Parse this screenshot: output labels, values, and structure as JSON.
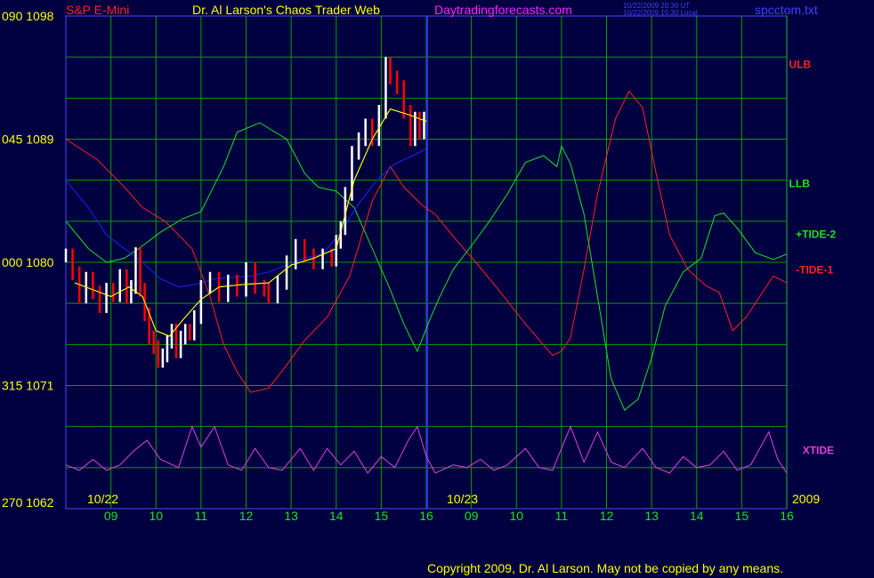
{
  "header": {
    "instrument": "S&P E-Mini",
    "title": "Dr. Al Larson's Chaos Trader Web",
    "site": "Daytradingforecasts.com",
    "timestamp_ut": "10/22/2009 20:30 UT",
    "timestamp_local": "10/22/2009 15:30 Local",
    "file": "spcctom.txt"
  },
  "footer": {
    "copyright": "Copyright 2009, Dr. Al Larson. May not be copied by any means."
  },
  "colors": {
    "background": "#000040",
    "grid": "#00a000",
    "frame": "#3030c0",
    "price_up": "#ffffff",
    "price_down": "#ff0000",
    "ulb": "#ff2020",
    "llb": "#20e020",
    "xtide": "#e040e0",
    "moving_avg": "#ffff00",
    "blue_line": "#2020ff",
    "divider": "#3030ff"
  },
  "chart_data": {
    "type": "line",
    "title": "S&P E-Mini",
    "ylabel": "",
    "y_axis_labels": [
      {
        "angle": "090",
        "price": "1098"
      },
      {
        "angle": "045",
        "price": "1089"
      },
      {
        "angle": "000",
        "price": "1080"
      },
      {
        "angle": "315",
        "price": "1071"
      },
      {
        "angle": "270",
        "price": "1062"
      }
    ],
    "ylim": [
      1062,
      1098
    ],
    "xlim": [
      8,
      24
    ],
    "x_tick_labels": [
      "09",
      "10",
      "11",
      "12",
      "13",
      "14",
      "15",
      "16",
      "09",
      "10",
      "11",
      "12",
      "13",
      "14",
      "15",
      "16"
    ],
    "x_tick_positions": [
      9,
      10,
      11,
      12,
      13,
      14,
      15,
      16,
      17,
      18,
      19,
      20,
      21,
      22,
      23,
      24
    ],
    "date_labels": [
      "10/22",
      "10/23"
    ],
    "year_label": "2009",
    "divider_x": 16,
    "series": [
      {
        "name": "ULB",
        "points": [
          [
            8,
            1089
          ],
          [
            8.7,
            1087.5
          ],
          [
            9.3,
            1085.5
          ],
          [
            9.7,
            1084
          ],
          [
            10.2,
            1083
          ],
          [
            10.8,
            1081
          ],
          [
            11.2,
            1077.5
          ],
          [
            11.5,
            1074
          ],
          [
            11.8,
            1072
          ],
          [
            12.1,
            1070.5
          ],
          [
            12.5,
            1070.8
          ],
          [
            12.9,
            1072.5
          ],
          [
            13.3,
            1074.3
          ],
          [
            13.8,
            1076
          ],
          [
            14.3,
            1079
          ],
          [
            14.8,
            1084.5
          ],
          [
            15.2,
            1087
          ],
          [
            15.5,
            1085.5
          ],
          [
            15.9,
            1084.2
          ],
          [
            16.2,
            1083.5
          ],
          [
            16.7,
            1081.5
          ],
          [
            17.1,
            1080
          ],
          [
            17.6,
            1078
          ],
          [
            18.2,
            1075.5
          ],
          [
            18.8,
            1073.2
          ],
          [
            19,
            1073.5
          ],
          [
            19.2,
            1074.5
          ],
          [
            19.5,
            1079.5
          ],
          [
            19.8,
            1085
          ],
          [
            20.2,
            1090.5
          ],
          [
            20.5,
            1092.5
          ],
          [
            20.8,
            1091.3
          ],
          [
            21.1,
            1086.5
          ],
          [
            21.4,
            1082
          ],
          [
            21.8,
            1079.5
          ],
          [
            22.2,
            1078.3
          ],
          [
            22.5,
            1077.8
          ],
          [
            22.8,
            1075
          ],
          [
            23.1,
            1076
          ],
          [
            23.4,
            1077.5
          ],
          [
            23.7,
            1079
          ],
          [
            24,
            1078.5
          ]
        ]
      },
      {
        "name": "LLB",
        "points": [
          [
            8,
            1083
          ],
          [
            8.5,
            1081
          ],
          [
            8.9,
            1080
          ],
          [
            9.3,
            1080.3
          ],
          [
            9.7,
            1081.2
          ],
          [
            10.1,
            1082.2
          ],
          [
            10.6,
            1083.2
          ],
          [
            11,
            1083.7
          ],
          [
            11.5,
            1087
          ],
          [
            11.8,
            1089.5
          ],
          [
            12.3,
            1090.2
          ],
          [
            12.9,
            1089
          ],
          [
            13.3,
            1086.5
          ],
          [
            13.6,
            1085.5
          ],
          [
            14,
            1085.2
          ],
          [
            14.4,
            1084
          ],
          [
            14.8,
            1081
          ],
          [
            15.2,
            1078
          ],
          [
            15.5,
            1075.5
          ],
          [
            15.8,
            1073.5
          ],
          [
            16.1,
            1076
          ],
          [
            16.3,
            1077.5
          ],
          [
            16.6,
            1079.5
          ],
          [
            17,
            1081.2
          ],
          [
            17.4,
            1083
          ],
          [
            17.8,
            1085
          ],
          [
            18.2,
            1087.3
          ],
          [
            18.6,
            1087.8
          ],
          [
            18.9,
            1087
          ],
          [
            19,
            1088.5
          ],
          [
            19.2,
            1087.2
          ],
          [
            19.5,
            1083.5
          ],
          [
            19.8,
            1077.5
          ],
          [
            20.1,
            1071.5
          ],
          [
            20.4,
            1069.2
          ],
          [
            20.7,
            1070
          ],
          [
            21,
            1073
          ],
          [
            21.3,
            1076.8
          ],
          [
            21.7,
            1079.3
          ],
          [
            22.1,
            1080.3
          ],
          [
            22.4,
            1083.4
          ],
          [
            22.6,
            1083.6
          ],
          [
            22.9,
            1082.5
          ],
          [
            23.3,
            1080.7
          ],
          [
            23.7,
            1080.2
          ],
          [
            24,
            1080.6
          ]
        ]
      },
      {
        "name": "XTIDE",
        "points": [
          [
            8,
            1065.2
          ],
          [
            8.3,
            1064.8
          ],
          [
            8.6,
            1065.6
          ],
          [
            8.9,
            1064.8
          ],
          [
            9.2,
            1065.2
          ],
          [
            9.5,
            1066.2
          ],
          [
            9.8,
            1067
          ],
          [
            10.1,
            1065.6
          ],
          [
            10.5,
            1065
          ],
          [
            10.8,
            1068
          ],
          [
            11,
            1066.5
          ],
          [
            11.3,
            1068
          ],
          [
            11.6,
            1065.2
          ],
          [
            11.9,
            1064.8
          ],
          [
            12.2,
            1066.4
          ],
          [
            12.5,
            1065
          ],
          [
            12.8,
            1064.8
          ],
          [
            13.2,
            1066.4
          ],
          [
            13.5,
            1064.8
          ],
          [
            13.8,
            1066.4
          ],
          [
            14.1,
            1065.2
          ],
          [
            14.4,
            1066.2
          ],
          [
            14.7,
            1064.6
          ],
          [
            15,
            1065.8
          ],
          [
            15.3,
            1065
          ],
          [
            15.6,
            1067
          ],
          [
            15.8,
            1068
          ],
          [
            16,
            1065.8
          ],
          [
            16.2,
            1064.6
          ],
          [
            16.6,
            1065.2
          ],
          [
            16.9,
            1065
          ],
          [
            17.2,
            1065.6
          ],
          [
            17.5,
            1064.8
          ],
          [
            17.8,
            1065.2
          ],
          [
            18.2,
            1066.4
          ],
          [
            18.5,
            1065
          ],
          [
            18.8,
            1064.8
          ],
          [
            19.2,
            1068
          ],
          [
            19.5,
            1065.4
          ],
          [
            19.8,
            1067.6
          ],
          [
            20.1,
            1065.4
          ],
          [
            20.4,
            1065
          ],
          [
            20.8,
            1066.4
          ],
          [
            21.1,
            1065
          ],
          [
            21.4,
            1064.6
          ],
          [
            21.7,
            1065.8
          ],
          [
            22,
            1065
          ],
          [
            22.3,
            1065.2
          ],
          [
            22.6,
            1066.2
          ],
          [
            22.9,
            1064.8
          ],
          [
            23.2,
            1065.2
          ],
          [
            23.6,
            1067.6
          ],
          [
            23.8,
            1065.6
          ],
          [
            24,
            1064.6
          ]
        ]
      },
      {
        "name": "blue",
        "points": [
          [
            8,
            1086
          ],
          [
            8.5,
            1084
          ],
          [
            8.9,
            1082
          ],
          [
            9.3,
            1081
          ],
          [
            9.7,
            1080
          ],
          [
            10.1,
            1078.8
          ],
          [
            10.5,
            1078.2
          ],
          [
            10.9,
            1078.4
          ],
          [
            11.3,
            1078.8
          ],
          [
            11.7,
            1078.9
          ],
          [
            12.1,
            1079
          ],
          [
            12.5,
            1079.3
          ],
          [
            12.9,
            1079.8
          ],
          [
            13.3,
            1080.3
          ],
          [
            13.7,
            1080.6
          ],
          [
            14.1,
            1082.2
          ],
          [
            14.5,
            1084.3
          ],
          [
            14.9,
            1086
          ],
          [
            15.3,
            1087.2
          ],
          [
            15.7,
            1087.8
          ],
          [
            16,
            1088.3
          ]
        ]
      },
      {
        "name": "price",
        "points": [
          [
            8,
            1080.5
          ],
          [
            8.15,
            1079.2
          ],
          [
            8.3,
            1077.5
          ],
          [
            8.45,
            1078.8
          ],
          [
            8.6,
            1077.8
          ],
          [
            8.75,
            1076.8
          ],
          [
            8.9,
            1078
          ],
          [
            9.05,
            1077.6
          ],
          [
            9.2,
            1079
          ],
          [
            9.35,
            1077.5
          ],
          [
            9.45,
            1078.2
          ],
          [
            9.55,
            1080.6
          ],
          [
            9.65,
            1078
          ],
          [
            9.75,
            1076.2
          ],
          [
            9.85,
            1074.5
          ],
          [
            9.95,
            1073.8
          ],
          [
            10.05,
            1072.8
          ],
          [
            10.15,
            1073.2
          ],
          [
            10.25,
            1074.2
          ],
          [
            10.35,
            1075
          ],
          [
            10.45,
            1073.5
          ],
          [
            10.55,
            1074.5
          ],
          [
            10.65,
            1075
          ],
          [
            10.75,
            1074.8
          ],
          [
            10.85,
            1076
          ],
          [
            11,
            1078.2
          ],
          [
            11.2,
            1078.8
          ],
          [
            11.4,
            1077.6
          ],
          [
            11.6,
            1078.6
          ],
          [
            11.8,
            1078
          ],
          [
            12,
            1079.5
          ],
          [
            12.2,
            1078.2
          ],
          [
            12.4,
            1078
          ],
          [
            12.5,
            1077.5
          ],
          [
            12.7,
            1078.5
          ],
          [
            12.9,
            1080
          ],
          [
            13.1,
            1081.2
          ],
          [
            13.3,
            1080.5
          ],
          [
            13.5,
            1080
          ],
          [
            13.7,
            1080.5
          ],
          [
            13.9,
            1080.2
          ],
          [
            14,
            1081.5
          ],
          [
            14.1,
            1082.5
          ],
          [
            14.2,
            1085
          ],
          [
            14.35,
            1088
          ],
          [
            14.5,
            1089
          ],
          [
            14.65,
            1090
          ],
          [
            14.8,
            1089
          ],
          [
            14.95,
            1091
          ],
          [
            15.1,
            1094.5
          ],
          [
            15.2,
            1093.5
          ],
          [
            15.35,
            1092.8
          ],
          [
            15.5,
            1091
          ],
          [
            15.65,
            1089
          ],
          [
            15.75,
            1090.5
          ],
          [
            15.85,
            1089.5
          ],
          [
            15.95,
            1090.5
          ]
        ]
      },
      {
        "name": "moving_avg",
        "points": [
          [
            8.2,
            1078.5
          ],
          [
            8.6,
            1078
          ],
          [
            9,
            1077.5
          ],
          [
            9.4,
            1078.2
          ],
          [
            9.7,
            1077.5
          ],
          [
            10,
            1075
          ],
          [
            10.3,
            1074.6
          ],
          [
            10.6,
            1075.8
          ],
          [
            11,
            1077.3
          ],
          [
            11.4,
            1078.2
          ],
          [
            12,
            1078.4
          ],
          [
            12.5,
            1078.5
          ],
          [
            13,
            1079.8
          ],
          [
            13.5,
            1080.3
          ],
          [
            14,
            1081
          ],
          [
            14.4,
            1086
          ],
          [
            14.8,
            1089
          ],
          [
            15.2,
            1091.2
          ],
          [
            15.6,
            1090.8
          ],
          [
            16,
            1090.3
          ]
        ]
      }
    ],
    "line_labels": [
      {
        "text": "ULB",
        "x": 24.05,
        "y": 1094.2,
        "color": "#ff2020"
      },
      {
        "text": "LLB",
        "x": 24.05,
        "y": 1085.5,
        "color": "#20e020"
      },
      {
        "text": "+TIDE-2",
        "x": 24.2,
        "y": 1081.8,
        "color": "#20e020"
      },
      {
        "text": "-TIDE-1",
        "x": 24.2,
        "y": 1079.2,
        "color": "#ff2020"
      },
      {
        "text": "XTIDE",
        "x": 24.35,
        "y": 1066.0,
        "color": "#e040e0"
      }
    ],
    "grid": true
  }
}
